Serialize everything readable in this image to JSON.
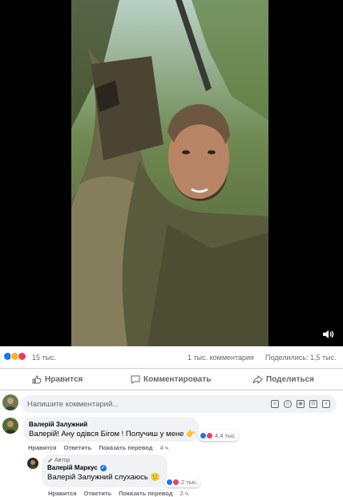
{
  "video": {
    "volume_icon": "speaker-icon"
  },
  "stats": {
    "reactions_count": "15 тыс.",
    "comments_count": "1 тыс. комментария",
    "shares_count": "Поделились: 1,5 тыс."
  },
  "actions": {
    "like": "Нравится",
    "comment": "Комментировать",
    "share": "Поделиться"
  },
  "composer": {
    "placeholder": "Напишите комментарий..."
  },
  "comments": [
    {
      "author": "Валерій Залужний",
      "text": "Валерій! Ану одівся Бігом ! Получиш у мене",
      "emoji": "👉",
      "reactions": "4,4 тыс.",
      "actions": {
        "like": "Нравится",
        "reply": "Ответить",
        "translate": "Показать перевод",
        "time": "4 ч."
      },
      "reply": {
        "badge": "Автор",
        "author": "Валерій Маркус",
        "verified": true,
        "text": "Валерій Залужний слухаюсь",
        "emoji": "🙂",
        "reactions": "2 тыс.",
        "actions": {
          "like": "Нравится",
          "reply": "Ответить",
          "translate": "Показать перевод",
          "time": "2 ч."
        }
      }
    }
  ],
  "colors": {
    "like_blue": "#1877f2",
    "love_red": "#f33e58",
    "haha_yellow": "#f7b125"
  }
}
